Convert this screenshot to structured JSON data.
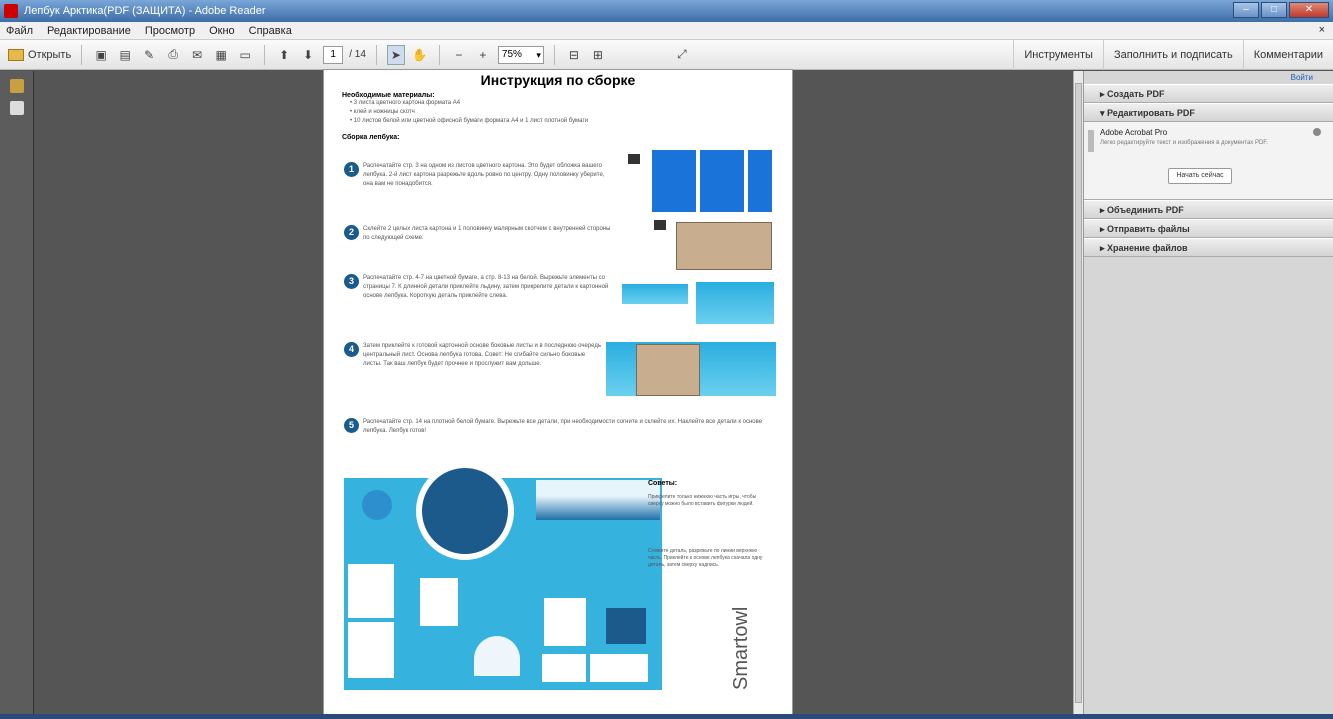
{
  "window": {
    "title": "Лепбук Арктика(PDF (ЗАЩИТА) - Adobe Reader"
  },
  "menu": {
    "items": [
      "Файл",
      "Редактирование",
      "Просмотр",
      "Окно",
      "Справка"
    ],
    "close": "×"
  },
  "toolbar": {
    "open_label": "Открыть",
    "page_current": "1",
    "page_total": "/ 14",
    "zoom": "75%",
    "right_tabs": [
      "Инструменты",
      "Заполнить и подписать",
      "Комментарии"
    ]
  },
  "document": {
    "title": "Инструкция по сборке",
    "materials_heading": "Необходимые материалы:",
    "materials": [
      "• 3 листа цветного картона формата А4",
      "• клей и ножницы скотч",
      "• 10 листов белой или цветной офисной бумаги формата А4 и 1 лист плотной бумаги"
    ],
    "assembly_heading": "Сборка лепбука:",
    "steps": [
      {
        "num": "1",
        "text": "Распечатайте стр. 3 на одном из листов цветного картона. Это будет обложка вашего лепбука. 2-й лист картона разрежьте вдоль ровно по центру. Одну половинку уберите, она вам не понадобится."
      },
      {
        "num": "2",
        "text": "Склейте 2 целых листа картона и 1 половинку малярным скотчем с внутренней стороны по следующей схеме:"
      },
      {
        "num": "3",
        "text": "Распечатайте стр. 4-7 на цветной бумаге, а стр. 8-13 на белой. Вырежьте элементы со страницы 7. К длинной детали приклейте льдину, затем прикрепите детали к картонной основе лепбука. Короткую деталь приклейте слева."
      },
      {
        "num": "4",
        "text": "Затем приклейте к готовой картонной основе боковые листы и в последнюю очередь центральный лист. Основа лепбука готова. Совет: Не сгибайте сильно боковые листы. Так ваш лепбук будет прочнее и прослужит вам дольше."
      },
      {
        "num": "5",
        "text": "Распечатайте стр. 14 на плотной белой бумаге. Вырежьте все детали, при необходимости согните и склейте их. Наклейте все детали к основе лепбука. Лепбук готов!"
      }
    ],
    "tips_heading": "Советы:",
    "tips": [
      "Прикрепите только нижнюю часть игры, чтобы сверху можно было вставить фигурки людей.",
      "Сложите деталь, разрежьте по линии верхнюю часть. Приклейте к основе лепбука сначала одну деталь, затем сверху надпись."
    ],
    "brand": "Smartowl"
  },
  "right_panel": {
    "login": "Войти",
    "sections": [
      "Создать PDF",
      "Редактировать PDF",
      "Объединить PDF",
      "Отправить файлы",
      "Хранение файлов"
    ],
    "acrobat": {
      "name": "Adobe Acrobat Pro",
      "desc": "Легко редактируйте текст и изображения в документах PDF.",
      "button": "Начать сейчас"
    }
  }
}
